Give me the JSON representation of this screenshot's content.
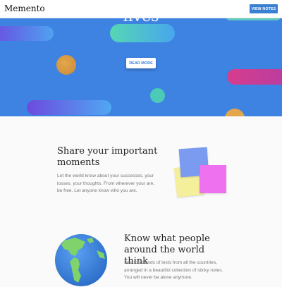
{
  "header": {
    "brand": "Memento",
    "view_notes_label": "VIEW NOTES"
  },
  "hero": {
    "cut_text": "lives",
    "read_more_label": "READ MORE"
  },
  "share_section": {
    "title": "Share your important moments",
    "body": "Let the world know about your successes, your losses, your thoughts. From wherever your are, be free. Let anyone know who you are."
  },
  "know_section": {
    "title": "Know what people around the world think",
    "body": "See thousands of texts from all the countries, arranged in a beautiful collection of sticky notes. You will never be alone anymore."
  },
  "colors": {
    "accent": "#3a80d2",
    "hero_bg": "#3e83e2",
    "note_blue": "#7b9bf0",
    "note_pink": "#ee72f0",
    "note_yellow": "#f4ef9a"
  },
  "icons": {
    "globe": "globe-icon"
  }
}
